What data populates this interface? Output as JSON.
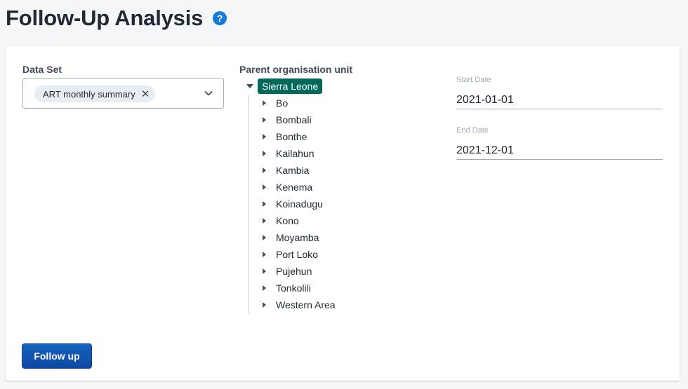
{
  "page": {
    "title": "Follow-Up Analysis",
    "help_icon": "help-circle-icon",
    "help_glyph": "?"
  },
  "colors": {
    "accent": "#147cd7",
    "selected_org_unit": "#00695c",
    "primary_button": "#1565c0"
  },
  "data_set": {
    "label": "Data Set",
    "selected": "ART monthly summary",
    "remove_glyph": "✕"
  },
  "org_unit_tree": {
    "label": "Parent organisation unit",
    "root": {
      "label": "Sierra Leone",
      "expanded": true,
      "selected": true
    },
    "children": [
      "Bo",
      "Bombali",
      "Bonthe",
      "Kailahun",
      "Kambia",
      "Kenema",
      "Koinadugu",
      "Kono",
      "Moyamba",
      "Port Loko",
      "Pujehun",
      "Tonkolili",
      "Western Area"
    ]
  },
  "start_date": {
    "label": "Start Date",
    "value": "2021-01-01"
  },
  "end_date": {
    "label": "End Date",
    "value": "2021-12-01"
  },
  "actions": {
    "follow_up_label": "Follow up"
  }
}
